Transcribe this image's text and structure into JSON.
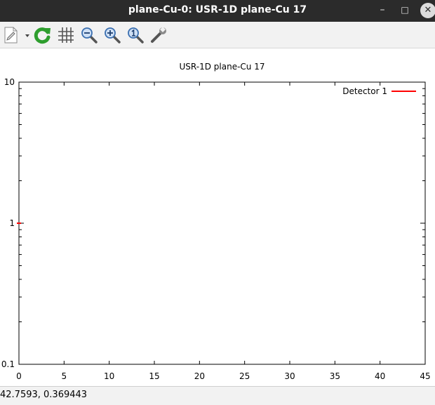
{
  "window": {
    "title": "plane-Cu-0: USR-1D plane-Cu 17",
    "minimize_glyph": "–",
    "maximize_glyph": "□",
    "close_glyph": "✕"
  },
  "toolbar": {
    "tools": [
      "export-icon",
      "replot-icon",
      "grid-icon",
      "zoom-out-icon",
      "zoom-in-icon",
      "zoom-reset-icon",
      "settings-wrench-icon"
    ],
    "accent_green": "#2e9e2e",
    "accent_blue": "#3a6fb0"
  },
  "status": {
    "coords": "42.7593,  0.369443"
  },
  "chart_data": {
    "type": "line",
    "title": "USR-1D plane-Cu 17",
    "xlabel": "",
    "ylabel": "",
    "xlim": [
      0,
      45
    ],
    "ylim": [
      0.1,
      10
    ],
    "yscale": "log",
    "xticks": [
      0,
      5,
      10,
      15,
      20,
      25,
      30,
      35,
      40,
      45
    ],
    "xtick_labels": [
      "0",
      "5",
      "10",
      "15",
      "20",
      "25",
      "30",
      "35",
      "40",
      "45"
    ],
    "yticks": [
      0.1,
      1,
      10
    ],
    "ytick_labels": [
      "0.1",
      "1",
      "10"
    ],
    "grid": false,
    "legend": "top-right",
    "series": [
      {
        "name": "Detector 1",
        "color": "#ff0000",
        "x": [
          0,
          0.15
        ],
        "y": [
          1,
          1
        ]
      }
    ]
  }
}
